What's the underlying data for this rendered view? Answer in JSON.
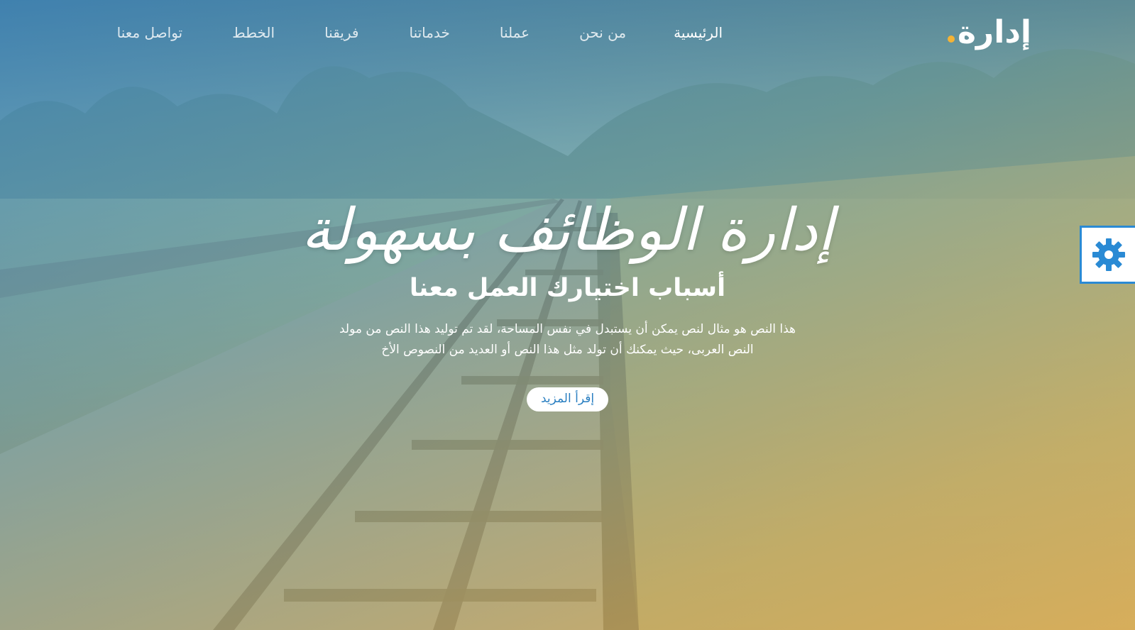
{
  "brand": {
    "name": "إدارة",
    "dot_color": "#f5b335"
  },
  "nav": {
    "items": [
      {
        "label": "الرئيسية",
        "active": true
      },
      {
        "label": "من نحن"
      },
      {
        "label": "عملنا"
      },
      {
        "label": "خدماتنا"
      },
      {
        "label": "فريقنا"
      },
      {
        "label": "الخطط"
      },
      {
        "label": "تواصل معنا"
      }
    ]
  },
  "hero": {
    "title": "إدارة الوظائف بسهولة",
    "subtitle": "أسباب اختيارك العمل معنا",
    "text": "هذا النص هو مثال لنص يمكن أن يستبدل في نفس المساحة، لقد تم توليد هذا النص من مولد النص العربى، حيث يمكنك أن تولد مثل هذا النص أو العديد من النصوص الأخ",
    "button_label": "إقرأ المزيد"
  },
  "settings": {
    "icon": "gear-icon",
    "color": "#2a8ad4"
  },
  "colors": {
    "overlay_top": "#408cc4",
    "overlay_bottom": "#f6be5a",
    "button_text": "#2a7fc1"
  }
}
